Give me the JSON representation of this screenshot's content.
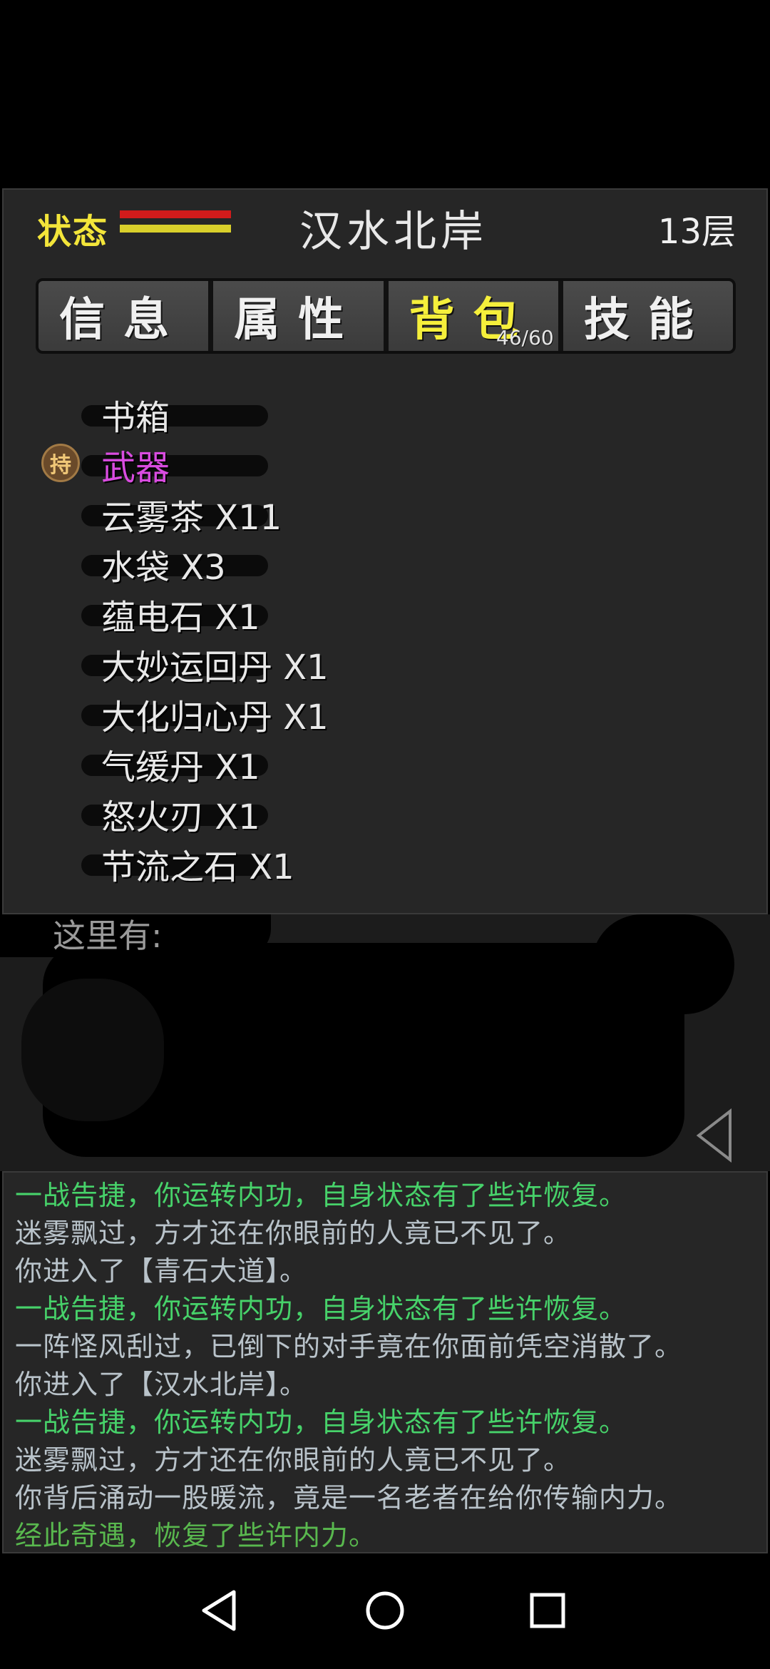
{
  "header": {
    "status_label": "状态",
    "location": "汉水北岸",
    "floor": "13层",
    "status_colors": [
      "#d21b1b",
      "#d9cf2b"
    ]
  },
  "tabs": [
    {
      "label": "信息",
      "active": false
    },
    {
      "label": "属性",
      "active": false
    },
    {
      "label": "背包",
      "active": true,
      "count": "46/60"
    },
    {
      "label": "技能",
      "active": false
    }
  ],
  "inventory": {
    "hold_badge": "持",
    "items": [
      {
        "label": "书箱",
        "equipped": false
      },
      {
        "label": "武器",
        "equipped": true
      },
      {
        "label": "云雾茶 X11",
        "equipped": false
      },
      {
        "label": "水袋 X3",
        "equipped": false
      },
      {
        "label": "蕴电石 X1",
        "equipped": false
      },
      {
        "label": "大妙运回丹 X1",
        "equipped": false
      },
      {
        "label": "大化归心丹 X1",
        "equipped": false
      },
      {
        "label": "气缓丹 X1",
        "equipped": false
      },
      {
        "label": "怒火刃 X1",
        "equipped": false
      },
      {
        "label": "节流之石 X1",
        "equipped": false
      }
    ]
  },
  "here": {
    "label": "这里有:"
  },
  "log": [
    {
      "text": "一战告捷，你运转内功，自身状态有了些许恢复。",
      "type": "success"
    },
    {
      "text": "迷雾飘过，方才还在你眼前的人竟已不见了。",
      "type": "info"
    },
    {
      "text": "你进入了【青石大道】。",
      "type": "info"
    },
    {
      "text": "一战告捷，你运转内功，自身状态有了些许恢复。",
      "type": "success"
    },
    {
      "text": "一阵怪风刮过，已倒下的对手竟在你面前凭空消散了。",
      "type": "info"
    },
    {
      "text": "你进入了【汉水北岸】。",
      "type": "info"
    },
    {
      "text": "一战告捷，你运转内功，自身状态有了些许恢复。",
      "type": "success"
    },
    {
      "text": "迷雾飘过，方才还在你眼前的人竟已不见了。",
      "type": "info"
    },
    {
      "text": "你背后涌动一股暖流，竟是一名老者在给你传输内力。",
      "type": "info"
    },
    {
      "text": "经此奇遇，恢复了些许内力。",
      "type": "gain"
    }
  ],
  "navbar": {
    "icons": [
      "back-icon",
      "home-icon",
      "recents-icon"
    ]
  }
}
